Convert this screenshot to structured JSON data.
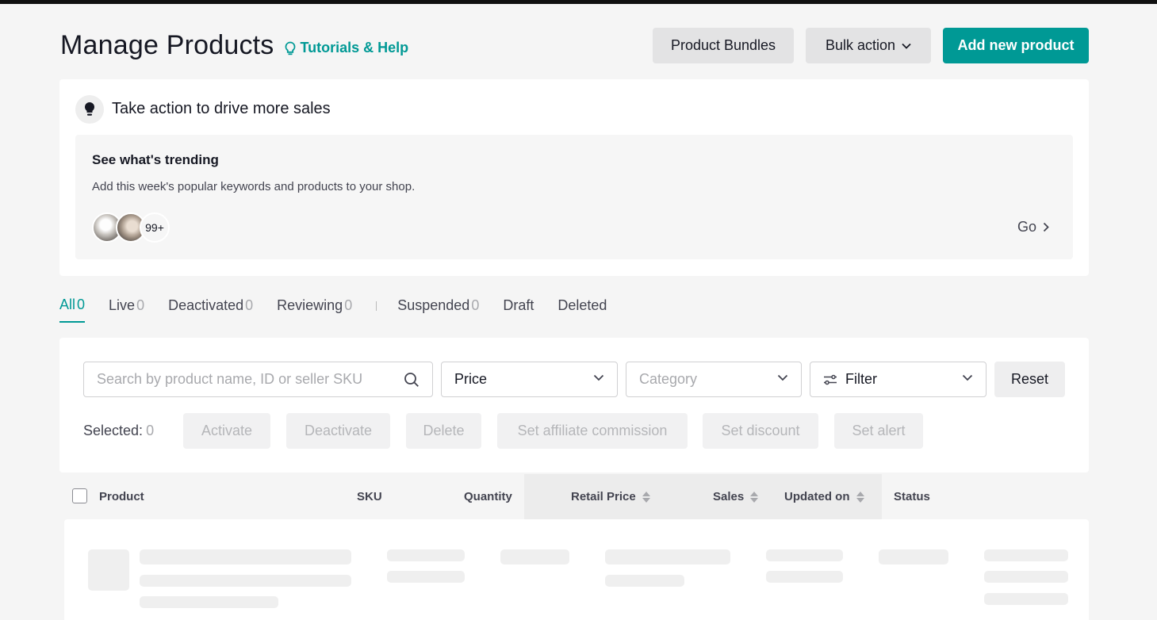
{
  "header": {
    "title": "Manage Products",
    "help_link": "Tutorials & Help",
    "product_bundles": "Product Bundles",
    "bulk_action": "Bulk action",
    "add_product": "Add new product"
  },
  "action_card": {
    "title": "Take action to drive more sales",
    "trend_title": "See what's trending",
    "trend_desc": "Add this week's popular keywords and products to your shop.",
    "more_count": "99+",
    "go_label": "Go"
  },
  "tabs": [
    {
      "label": "All",
      "count": "0"
    },
    {
      "label": "Live",
      "count": "0"
    },
    {
      "label": "Deactivated",
      "count": "0"
    },
    {
      "label": "Reviewing",
      "count": "0"
    },
    {
      "label": "Suspended",
      "count": "0"
    },
    {
      "label": "Draft",
      "count": ""
    },
    {
      "label": "Deleted",
      "count": ""
    }
  ],
  "filters": {
    "search_placeholder": "Search by product name, ID or seller SKU",
    "price": "Price",
    "category": "Category",
    "filter": "Filter",
    "reset": "Reset"
  },
  "bulk": {
    "selected_label": "Selected:",
    "selected_count": "0",
    "activate": "Activate",
    "deactivate": "Deactivate",
    "delete": "Delete",
    "set_affiliate": "Set affiliate commission",
    "set_discount": "Set discount",
    "set_alert": "Set alert"
  },
  "table": {
    "columns": {
      "product": "Product",
      "sku": "SKU",
      "quantity": "Quantity",
      "retail_price": "Retail Price",
      "sales": "Sales",
      "updated_on": "Updated on",
      "status": "Status"
    }
  },
  "colors": {
    "accent": "#009995",
    "background": "#f5f5f5",
    "text": "#161823"
  }
}
